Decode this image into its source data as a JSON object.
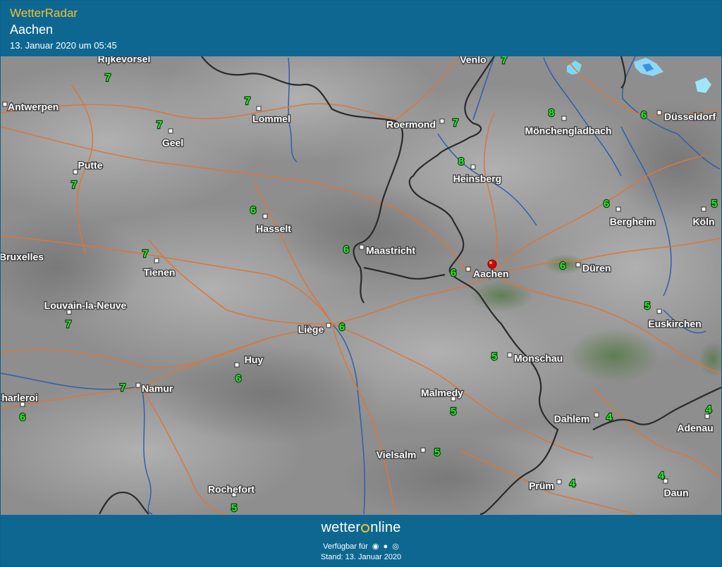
{
  "header": {
    "app_title": "WetterRadar",
    "location": "Aachen",
    "timestamp": "13. Januar 2020 um 05:45"
  },
  "map": {
    "marker_city": "Aachen",
    "cities": [
      {
        "name": "Rijkevorsel",
        "temp": "7"
      },
      {
        "name": "Antwerpen",
        "temp": ""
      },
      {
        "name": "Lommel",
        "temp": "7"
      },
      {
        "name": "Geel",
        "temp": "7"
      },
      {
        "name": "Putte",
        "temp": "7"
      },
      {
        "name": "Hasselt",
        "temp": "6"
      },
      {
        "name": "Tienen",
        "temp": "7"
      },
      {
        "name": "Bruxelles",
        "temp": ""
      },
      {
        "name": "Louvain-la-Neuve",
        "temp": "7"
      },
      {
        "name": "Venlo",
        "temp": "7"
      },
      {
        "name": "Roermond",
        "temp": "7"
      },
      {
        "name": "Heinsberg",
        "temp": "8"
      },
      {
        "name": "Mönchengladbach",
        "temp": "8"
      },
      {
        "name": "Düsseldorf",
        "temp": "6"
      },
      {
        "name": "Maastricht",
        "temp": "6"
      },
      {
        "name": "Aachen",
        "temp": "6"
      },
      {
        "name": "Bergheim",
        "temp": "6"
      },
      {
        "name": "Köln",
        "temp": "5"
      },
      {
        "name": "Düren",
        "temp": "6"
      },
      {
        "name": "Liège",
        "temp": "6"
      },
      {
        "name": "Euskirchen",
        "temp": "5"
      },
      {
        "name": "Huy",
        "temp": "6"
      },
      {
        "name": "Monschau",
        "temp": "5"
      },
      {
        "name": "Namur",
        "temp": "7"
      },
      {
        "name": "Charleroi",
        "temp": "6"
      },
      {
        "name": "Malmedy",
        "temp": "5"
      },
      {
        "name": "Dahlem",
        "temp": "4"
      },
      {
        "name": "Adenau",
        "temp": "4"
      },
      {
        "name": "Vielsalm",
        "temp": "5"
      },
      {
        "name": "Prüm",
        "temp": "4"
      },
      {
        "name": "Rochefort",
        "temp": "5"
      },
      {
        "name": "Daun",
        "temp": "4"
      }
    ]
  },
  "footer": {
    "brand_left": "wetter",
    "brand_right": "nline",
    "available_text": "Verfügbar für",
    "platform_icons": [
      "android-icon",
      "apple-icon",
      "windows-icon"
    ],
    "stand_text": "Stand: 13. Januar 2020"
  },
  "colors": {
    "header_bg": "#0e6791",
    "title_accent": "#f1c232",
    "temperature": "#2ee82e",
    "roads": "#d9773a",
    "rivers": "#2f5fa8",
    "borders": "#2a2a2a",
    "marker": "#e00000"
  }
}
